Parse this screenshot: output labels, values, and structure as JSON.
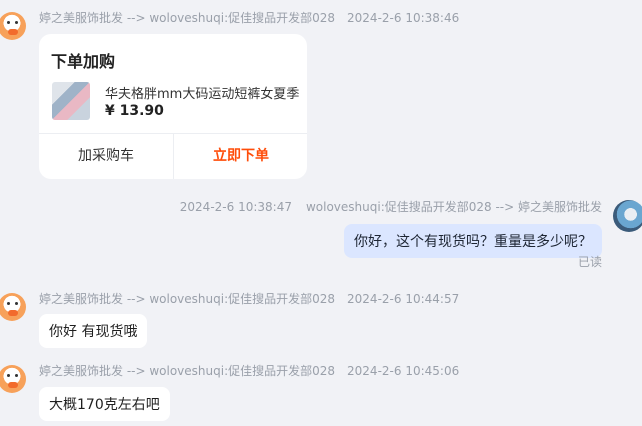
{
  "messages": [
    {
      "sender": "婷之美服饰批发 --> woloveshuqi:促佳搜品开发部028",
      "time": "2024-2-6 10:38:46",
      "card": {
        "title": "下单加购",
        "product_name": "华夫格胖mm大码运动短裤女夏季",
        "price": "¥ 13.90",
        "add_cart_label": "加采购车",
        "buy_now_label": "立即下单"
      }
    },
    {
      "sender": "woloveshuqi:促佳搜品开发部028 --> 婷之美服饰批发",
      "time": "2024-2-6 10:38:47",
      "text": "你好，这个有现货吗？重量是多少呢？",
      "read_status": "已读"
    },
    {
      "sender": "婷之美服饰批发 --> woloveshuqi:促佳搜品开发部028",
      "time": "2024-2-6 10:44:57",
      "text": "你好 有现货哦"
    },
    {
      "sender": "婷之美服饰批发 --> woloveshuqi:促佳搜品开发部028",
      "time": "2024-2-6 10:45:06",
      "text": "大概170克左右吧"
    }
  ],
  "colors": {
    "background": "#f1f2f6",
    "my_bubble": "#dbe6ff",
    "accent_buy": "#ff4d0a"
  },
  "icons": {
    "seller_avatar": "duck-avatar-icon",
    "user_avatar": "user-avatar-icon"
  }
}
